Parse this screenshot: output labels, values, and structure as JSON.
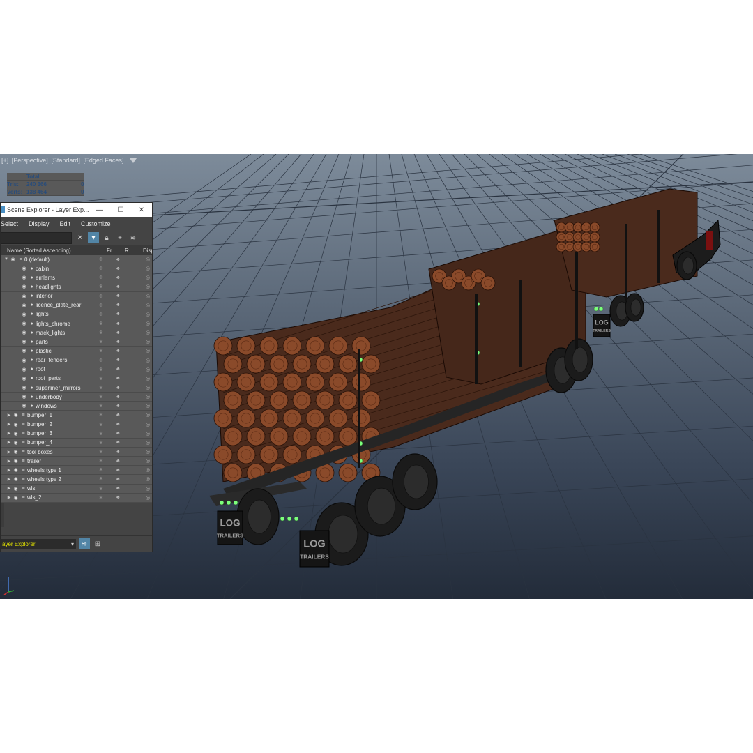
{
  "viewport": {
    "label": [
      "[+]",
      "[Perspective]",
      "[Standard]",
      "[Edged Faces]"
    ],
    "stats": {
      "header": "Total",
      "rows": [
        {
          "label": "Tris:",
          "total": "240 366",
          "sel": "0"
        },
        {
          "label": "Verts:",
          "total": "138 464",
          "sel": "0"
        }
      ]
    },
    "mud_flap_text": [
      "LOG",
      "TRAILERS"
    ]
  },
  "panel": {
    "title": "Scene Explorer - Layer Exp...",
    "window_buttons": [
      "—",
      "☐",
      "✕"
    ],
    "menu": [
      "Select",
      "Display",
      "Edit",
      "Customize"
    ],
    "columns": {
      "name": "Name (Sorted Ascending)",
      "freeze": "Fr...",
      "render": "R...",
      "display": "Display as"
    },
    "root_layer": "0 (default)",
    "children": [
      "cabin",
      "emlems",
      "headlights",
      "interior",
      "licence_plate_rear",
      "lights",
      "lights_chrome",
      "mack_lights",
      "parts",
      "plastic",
      "rear_fenders",
      "roof",
      "roof_parts",
      "superliner_mirrors",
      "underbody",
      "windows"
    ],
    "layers": [
      "bumper_1",
      "bumper_2",
      "bumper_3",
      "bumper_4",
      "tool boxes",
      "trailer",
      "wheels type 1",
      "wheels type 2",
      "wls",
      "wls_2"
    ],
    "explorer_dropdown": "ayer Explorer"
  }
}
